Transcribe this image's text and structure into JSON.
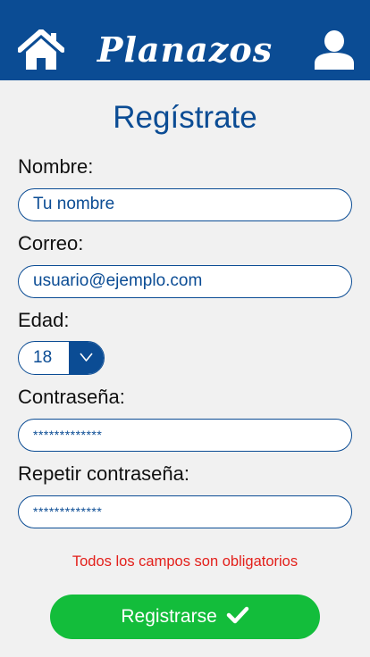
{
  "header": {
    "brand": "Planazos",
    "home_icon": "home-icon",
    "user_icon": "user-icon"
  },
  "form": {
    "title": "Regístrate",
    "name_label": "Nombre:",
    "name_placeholder": "Tu nombre",
    "email_label": "Correo:",
    "email_placeholder": "usuario@ejemplo.com",
    "age_label": "Edad:",
    "age_value": "18",
    "password_label": "Contraseña:",
    "password_value": "*************",
    "repeat_label": "Repetir contraseña:",
    "repeat_value": "*************",
    "warning": "Todos los campos son obligatorios",
    "submit_label": "Registrarse",
    "submit_icon": "check-icon"
  },
  "colors": {
    "brand_blue": "#0b4c94",
    "background": "#f1f1f1",
    "error_red": "#e3201b",
    "submit_green": "#13bd3b"
  }
}
